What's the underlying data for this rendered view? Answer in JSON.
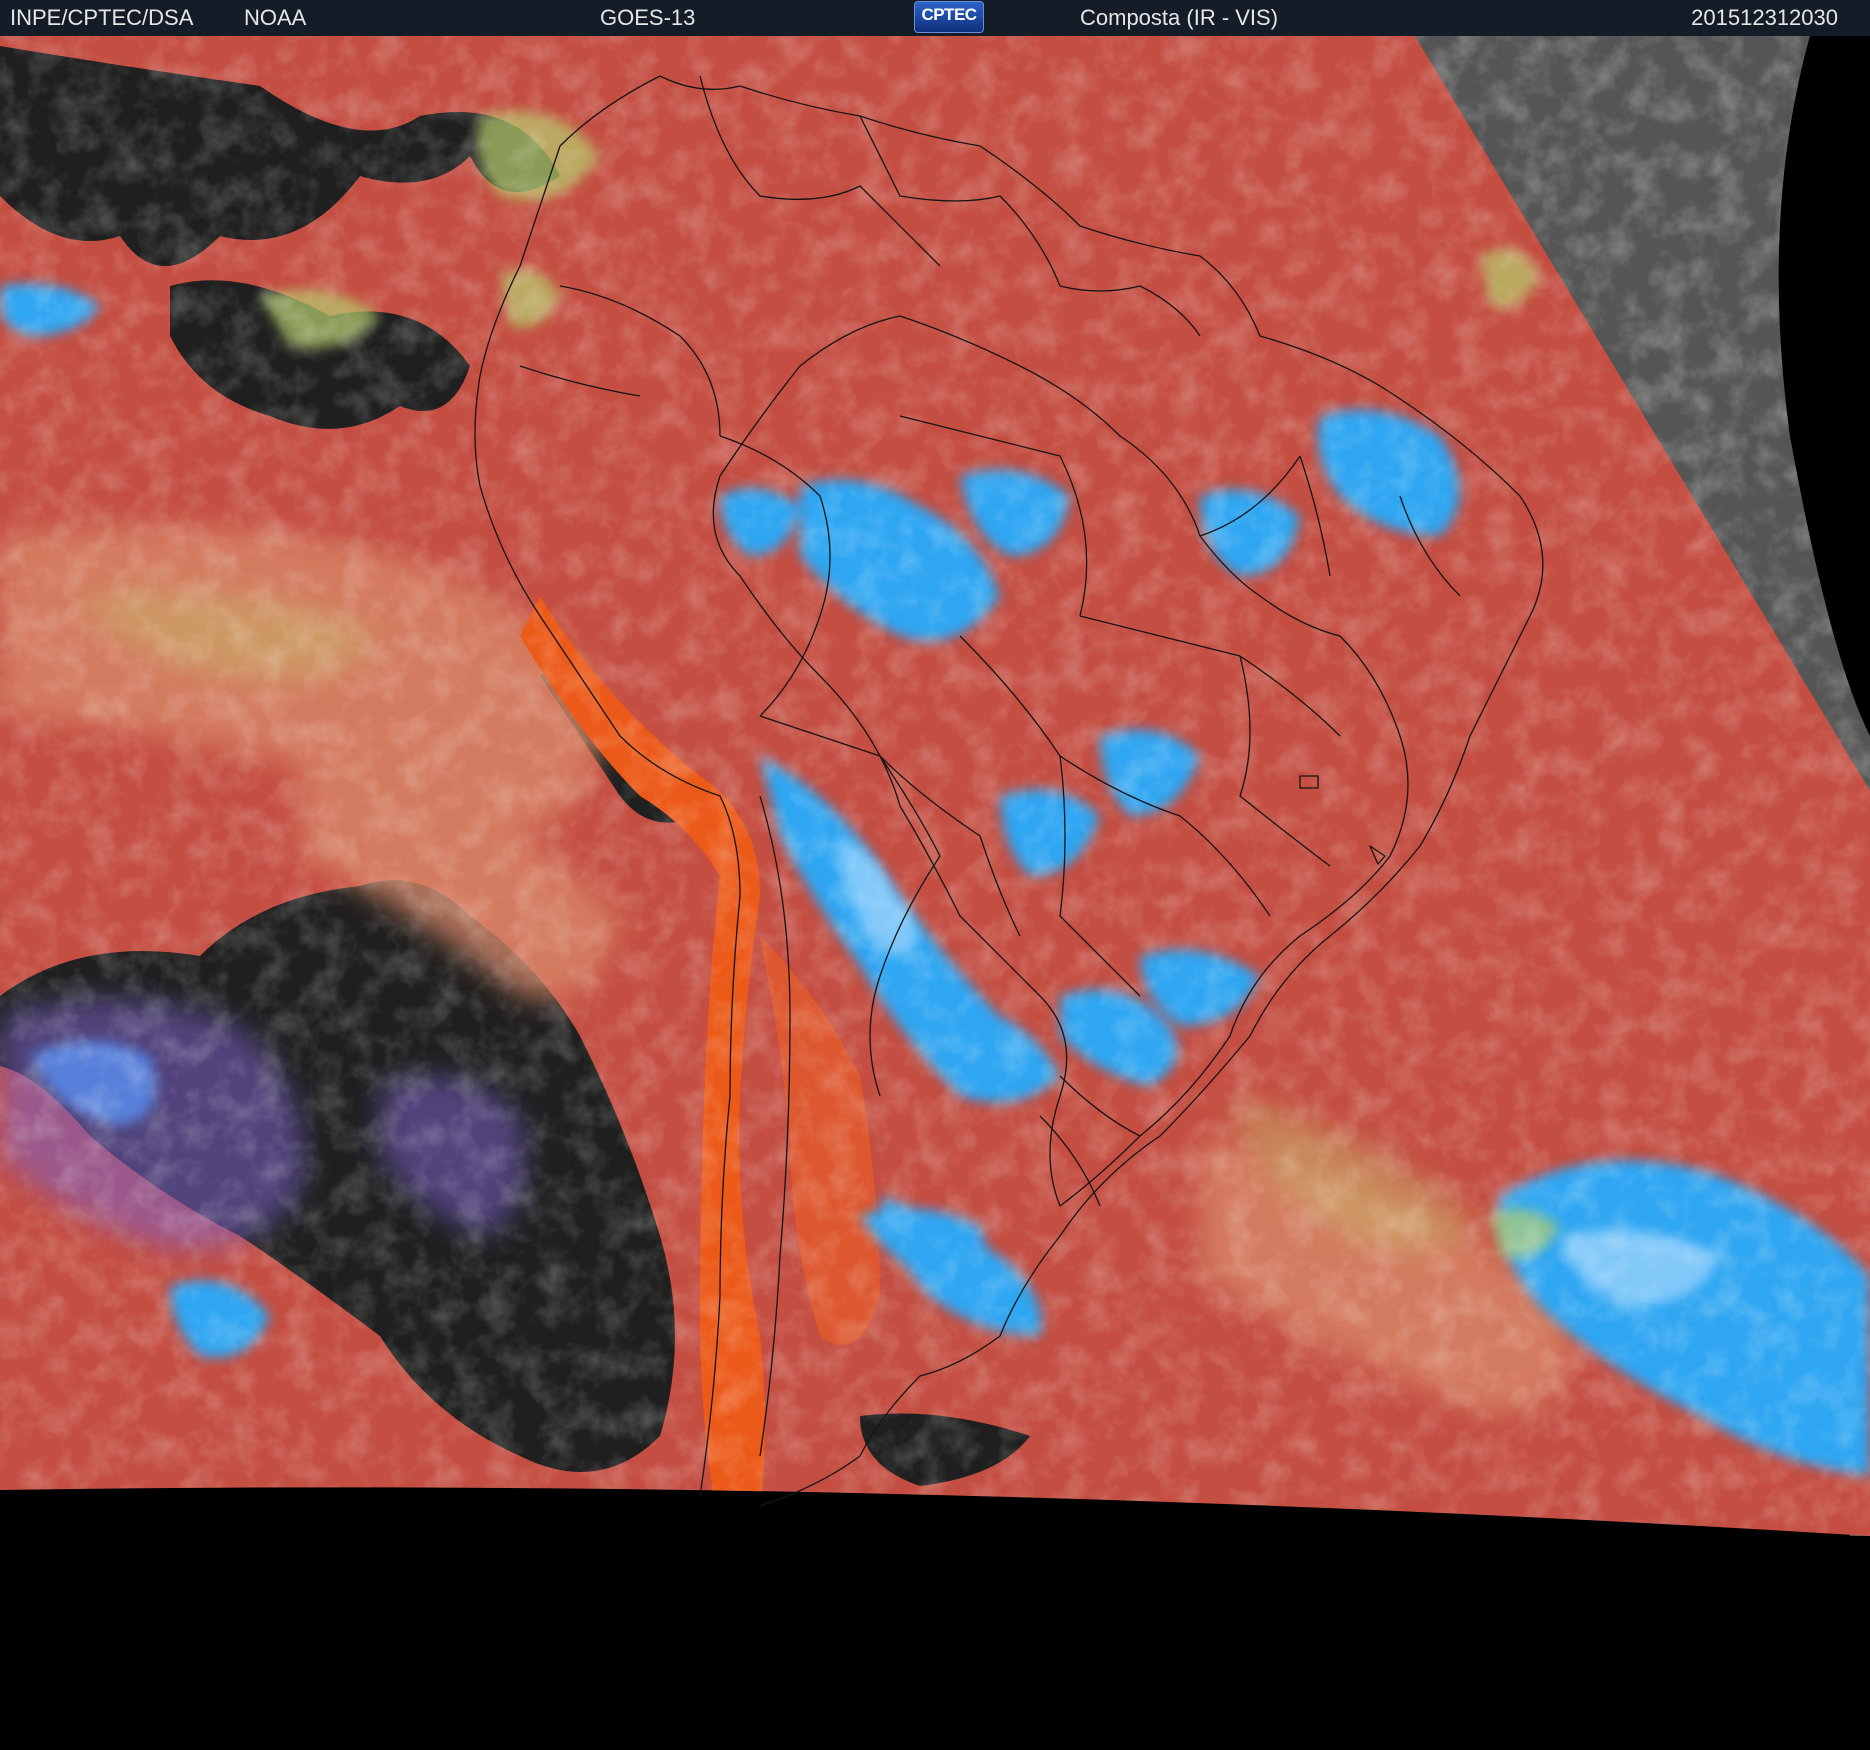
{
  "header": {
    "organization": "INPE/CPTEC/DSA",
    "agency": "NOAA",
    "satellite": "GOES-13",
    "logo_text": "CPTEC",
    "product": "Composta (IR - VIS)",
    "timestamp": "201512312030"
  },
  "colors": {
    "header_bg": "#141c27",
    "space_bg": "#000000",
    "warm_surface": "#c8503e",
    "coastal_orange": "#e8541c",
    "cold_cloud_blue": "#33a6f0",
    "cloud_yellow_green": "#b8c86a",
    "clear_ocean_dark": "#1e1e1e",
    "visible_gray": "#606060",
    "borders": "#101010"
  }
}
